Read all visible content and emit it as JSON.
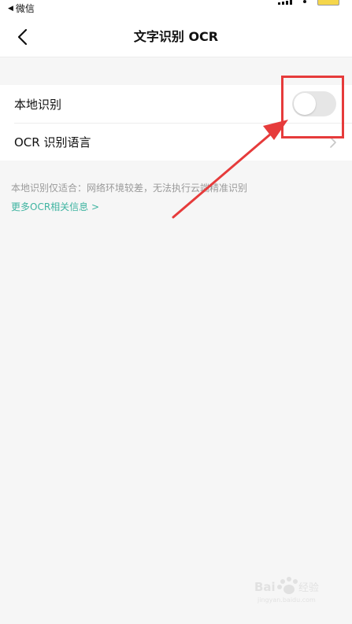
{
  "status_bar": {
    "back_label": "微信",
    "back_glyph": "◀"
  },
  "nav": {
    "title": "文字识别 OCR"
  },
  "settings": {
    "local_recognition": {
      "label": "本地识别",
      "toggle_on": false
    },
    "ocr_language": {
      "label": "OCR 识别语言"
    }
  },
  "footnote": {
    "text": "本地识别仅适合：网络环境较差，无法执行云端精准识别",
    "more_link": "更多OCR相关信息 >"
  },
  "colors": {
    "accent": "#3fb4a1",
    "annotation": "#e63b3b",
    "background": "#f6f6f6"
  }
}
